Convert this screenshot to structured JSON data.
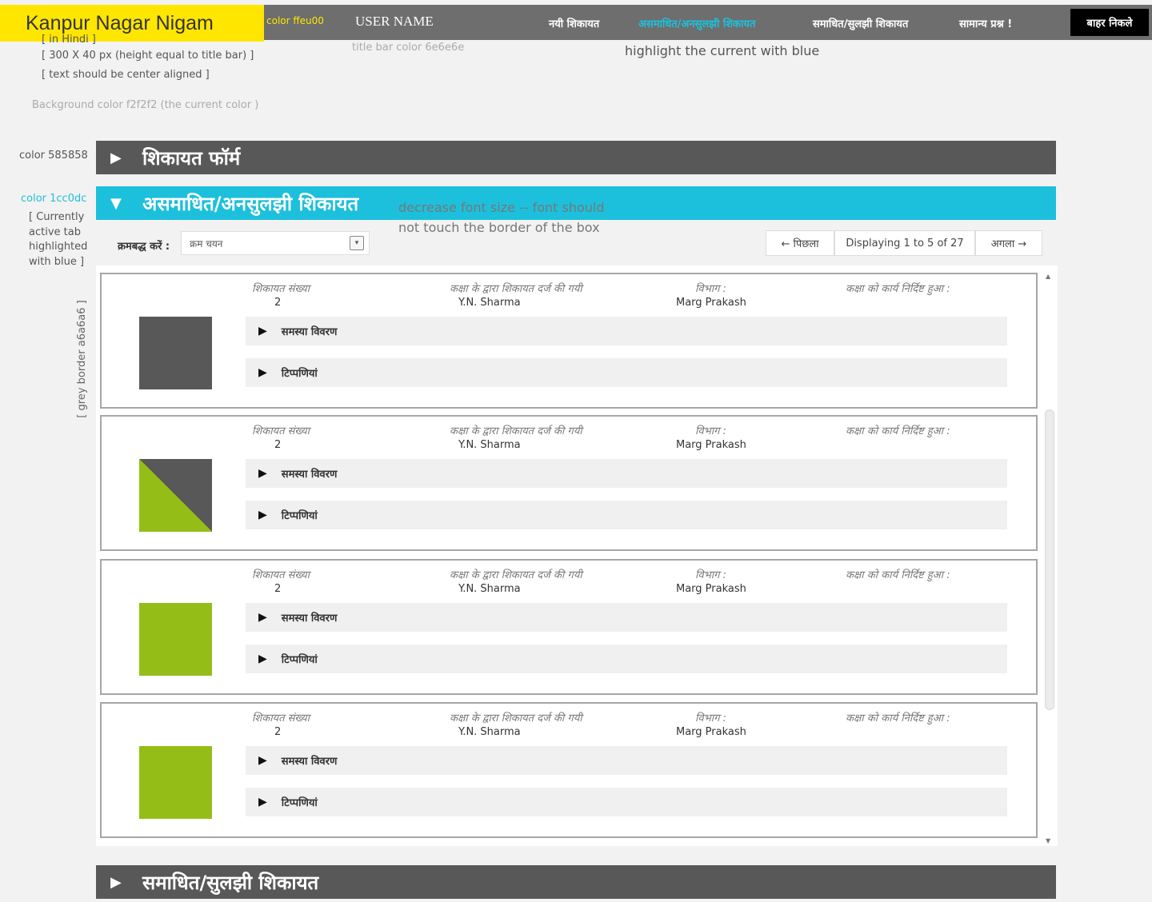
{
  "header": {
    "logo": "Kanpur Nagar Nigam",
    "logo_color_note": "color ffeu00",
    "username": "USER NAME",
    "title_bar_note": "title bar color 6e6e6e",
    "nav": [
      {
        "label": "नयी शिकायत",
        "active": false
      },
      {
        "label": "असमाधित/अनसुलझी शिकायत",
        "active": true
      },
      {
        "label": "समाधित/सुलझी शिकायत",
        "active": false
      },
      {
        "label": "सामान्य प्रश्न !",
        "active": false
      }
    ],
    "logout": "बाहर निकले",
    "highlight_note": "highlight the current with blue"
  },
  "annotations": {
    "logo_notes": [
      "[ in Hindi ]",
      "[ 300 X 40 px (height equal to title bar) ]",
      "[ text should be center aligned ]"
    ],
    "background_note": "Background color f2f2f2 (the current color )",
    "color_585858": "color 585858",
    "color_1cc0dc": "color 1cc0dc",
    "active_tab_note": [
      "[ Currently",
      "active tab",
      "highlighted",
      "with blue ]"
    ],
    "font_note": [
      "decrease font size -- font should",
      "not touch the border of the box"
    ],
    "grey_border_note": "[ grey border a6a6a6 ]"
  },
  "sections": {
    "form": "शिकायत फॉर्म",
    "unresolved": "असमाधित/अनसुलझी शिकायत",
    "resolved": "समाधित/सुलझी शिकायत"
  },
  "filter": {
    "label": "क्रमबद्ध करें :",
    "value": "क्रम चयन"
  },
  "pager": {
    "prev": "← पिछला",
    "status": "Displaying 1 to 5 of 27",
    "next": "अगला →"
  },
  "columns": {
    "number": "शिकायत संख्या",
    "filed_by": "कक्षा के द्वारा शिकायत दर्ज की गयी",
    "address": "विभाग :",
    "assigned": "कक्षा को कार्य निर्दिष्ट हुआ :"
  },
  "complaints": [
    {
      "number": "2",
      "filed_by": "Y.N. Sharma",
      "address": "Marg Prakash",
      "status_color": "#585858"
    },
    {
      "number": "2",
      "filed_by": "Y.N. Sharma",
      "address": "Marg Prakash",
      "status_color": "split"
    },
    {
      "number": "2",
      "filed_by": "Y.N. Sharma",
      "address": "Marg Prakash",
      "status_color": "#94be17"
    },
    {
      "number": "2",
      "filed_by": "Y.N. Sharma",
      "address": "Marg Prakash",
      "status_color": "#94be17"
    }
  ],
  "detail_rows": {
    "problem": "समस्या विवरण",
    "comments": "टिप्पणियां"
  },
  "colors": {
    "title_bar": "#6e6e6e",
    "logo_bg": "#ffe600",
    "accordion_dark": "#585858",
    "accordion_active": "#1cc0dc",
    "card_border": "#a6a6a6",
    "background": "#f2f2f2",
    "status_green": "#94be17"
  }
}
